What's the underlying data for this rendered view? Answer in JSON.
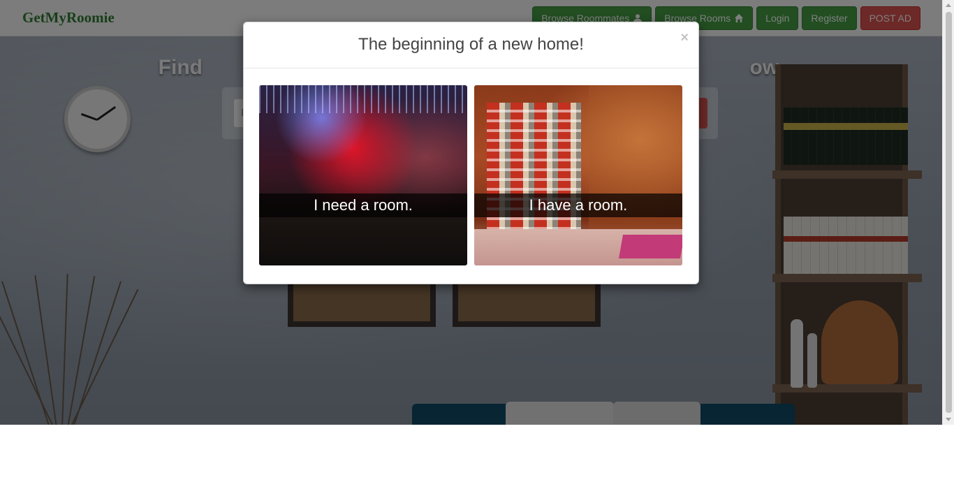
{
  "navbar": {
    "brand": "GetMyRoomie",
    "buttons": {
      "browse_roommates": "Browse Roommates",
      "browse_rooms": "Browse Rooms",
      "login": "Login",
      "register": "Register",
      "post_ad": "POST AD"
    },
    "icons": {
      "browse_roommates": "user-icon",
      "browse_rooms": "home-icon"
    }
  },
  "hero": {
    "title": "Find                                                                                              ow."
  },
  "search": {
    "placeholder_fragment": "P"
  },
  "modal": {
    "title": "The beginning of a new home!",
    "close_glyph": "×",
    "choices": [
      {
        "caption": "I need a room."
      },
      {
        "caption": "I have a room."
      }
    ]
  },
  "colors": {
    "brand": "#2e7d32",
    "button_green": "#449d44",
    "button_red": "#d9534f"
  }
}
